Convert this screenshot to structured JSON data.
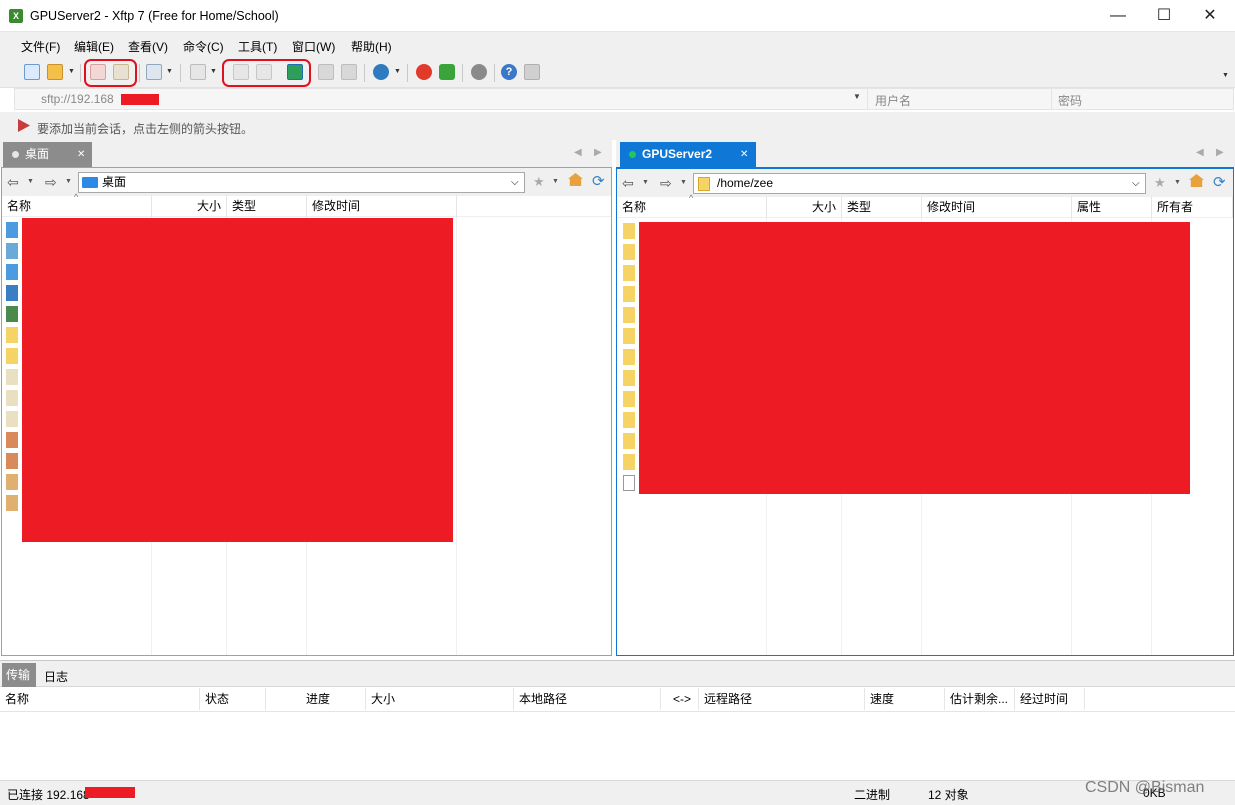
{
  "window": {
    "title": "GPUServer2 - Xftp 7 (Free for Home/School)",
    "minimize": "—",
    "maximize": "☐",
    "close": "✕"
  },
  "menu": [
    "文件(F)",
    "编辑(E)",
    "查看(V)",
    "命令(C)",
    "工具(T)",
    "窗口(W)",
    "帮助(H)"
  ],
  "address": {
    "host": "sftp://192.168",
    "username_placeholder": "用户名",
    "password_placeholder": "密码"
  },
  "hint": "要添加当前会话，点击左侧的箭头按钮。",
  "left_pane": {
    "tab_label": "桌面",
    "path": "桌面",
    "columns": [
      "名称",
      "大小",
      "类型",
      "修改时间"
    ]
  },
  "right_pane": {
    "tab_label": "GPUServer2",
    "path": "/home/zee",
    "columns": [
      "名称",
      "大小",
      "类型",
      "修改时间",
      "属性",
      "所有者"
    ]
  },
  "transfer": {
    "tabs": [
      "传输",
      "日志"
    ],
    "columns": [
      "名称",
      "状态",
      "进度",
      "大小",
      "本地路径",
      "<->",
      "远程路径",
      "速度",
      "估计剩余...",
      "经过时间"
    ]
  },
  "status": {
    "connection": "已连接 192.168",
    "mode": "二进制",
    "objects": "12 对象",
    "size": "0KB"
  },
  "watermark": "CSDN @Bisman",
  "colors": {
    "redaction": "#ed1c24",
    "active_tab": "#0f78d7",
    "connected_dot": "#22c55e",
    "annotation": "#e01020"
  }
}
